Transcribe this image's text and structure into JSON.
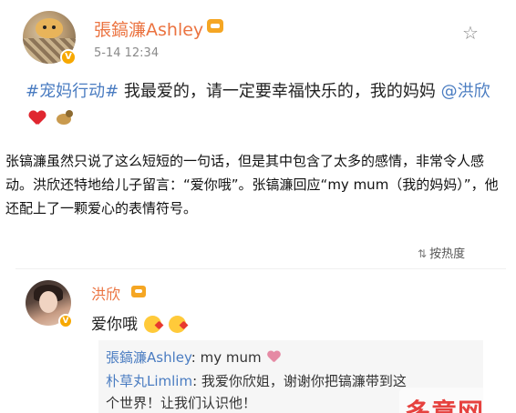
{
  "post": {
    "author": "張鎬濂Ashley",
    "time": "5-14 12:34",
    "topic": "#宠妈行动#",
    "text_main": " 我最爱的，请一定要幸福快乐的，我的妈妈 ",
    "mention": "@洪欣",
    "vip_badge": "V",
    "icons": [
      "heart-icon",
      "pet-emoji-icon"
    ],
    "accent_color": "#eb7340",
    "link_color": "#4a7cc1"
  },
  "article": {
    "paragraph": "张镐濂虽然只说了这么短短的一句话，但是其中包含了太多的感情，非常令人感动。洪欣还特地给儿子留言：“爱你哦”。张镐濂回应“my mum（我的妈妈）”，他还配上了一颗爱心的表情符号。"
  },
  "comments": {
    "sort_label": "按热度",
    "sort_icon": "⇅",
    "items": [
      {
        "name": "洪欣",
        "text": "爱你哦",
        "vip_badge": "V",
        "replies": [
          {
            "name": "張鎬濂Ashley",
            "text": ": my mum"
          },
          {
            "name": "朴草丸Limlim",
            "text": ": 我爱你欣姐，谢谢你把镐濂带到这"
          },
          {
            "name": "",
            "text": "个世界！让我们认识他！"
          }
        ]
      }
    ]
  },
  "watermark": {
    "text": "多意网"
  }
}
